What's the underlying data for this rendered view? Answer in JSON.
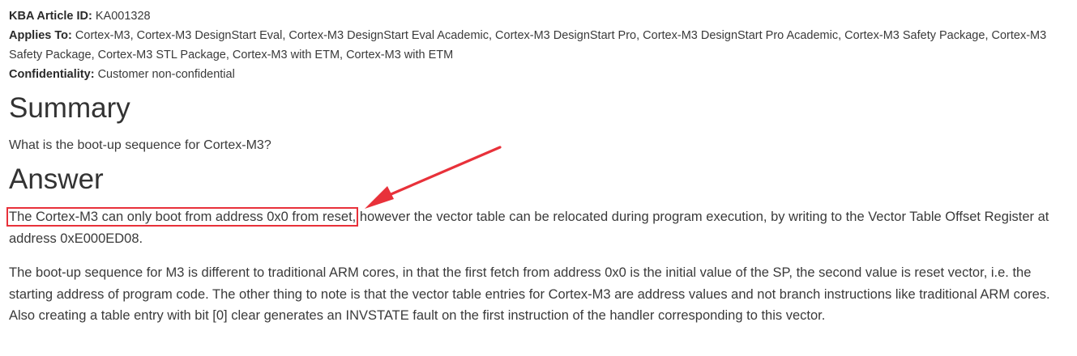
{
  "meta": {
    "article_id_label": "KBA Article ID:",
    "article_id": "KA001328",
    "applies_to_label": "Applies To:",
    "applies_to": "Cortex-M3, Cortex-M3 DesignStart Eval, Cortex-M3 DesignStart Eval Academic, Cortex-M3 DesignStart Pro, Cortex-M3 DesignStart Pro Academic, Cortex-M3 Safety Package, Cortex-M3 Safety Package, Cortex-M3 STL Package, Cortex-M3 with ETM, Cortex-M3 with ETM",
    "confidentiality_label": "Confidentiality:",
    "confidentiality": "Customer non-confidential"
  },
  "summary": {
    "heading": "Summary",
    "text": "What is the boot-up sequence for Cortex-M3?"
  },
  "answer": {
    "heading": "Answer",
    "para1_highlight": "The Cortex-M3 can only boot from address 0x0 from reset,",
    "para1_rest": " however the vector table can be relocated during program execution, by writing to the Vector Table Offset Register at address 0xE000ED08.",
    "para2": "The boot-up sequence for M3 is different to traditional ARM cores, in that the first fetch from address 0x0 is the initial value of the SP, the second value is reset vector, i.e. the starting address of program code. The other thing to note is that the vector table entries for Cortex-M3 are address values and not branch instructions like traditional ARM cores. Also creating a table entry with bit [0] clear generates an INVSTATE fault on the first instruction of the handler corresponding to this vector."
  },
  "annotation": {
    "color": "#e8313a"
  }
}
